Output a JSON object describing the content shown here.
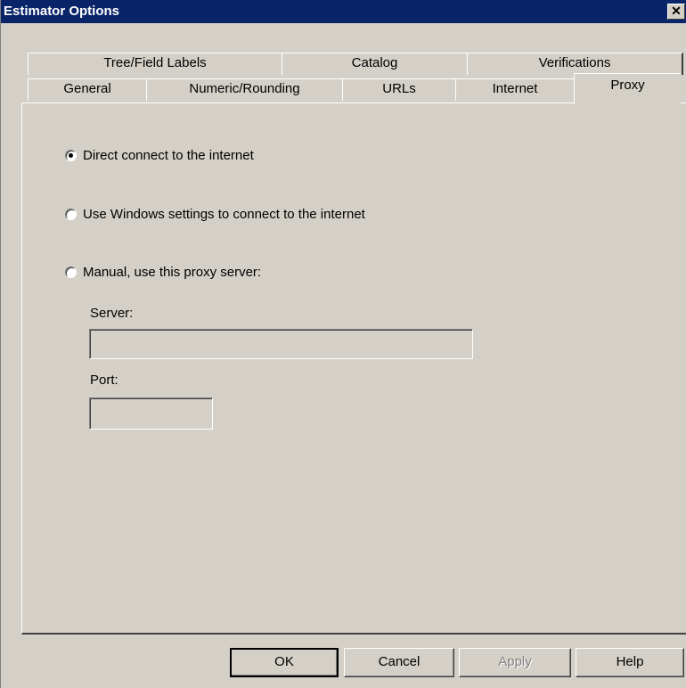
{
  "window": {
    "title": "Estimator Options",
    "close_glyph": "✕"
  },
  "tabs_back": [
    {
      "label": "Tree/Field Labels"
    },
    {
      "label": "Catalog"
    },
    {
      "label": "Verifications"
    }
  ],
  "tabs_front": [
    {
      "label": "General"
    },
    {
      "label": "Numeric/Rounding"
    },
    {
      "label": "URLs"
    },
    {
      "label": "Internet"
    },
    {
      "label": "Proxy",
      "active": true
    }
  ],
  "proxy": {
    "options": [
      {
        "label": "Direct connect to the internet",
        "checked": true
      },
      {
        "label": "Use Windows settings to connect to the internet",
        "checked": false
      },
      {
        "label": "Manual, use this proxy server:",
        "checked": false
      }
    ],
    "server_label": "Server:",
    "server_value": "",
    "port_label": "Port:",
    "port_value": ""
  },
  "buttons": {
    "ok": "OK",
    "cancel": "Cancel",
    "apply": "Apply",
    "help": "Help"
  },
  "icons": {
    "close": "close-icon",
    "radio": "radio-button-icon"
  },
  "colors": {
    "title_bar": "#0a246a",
    "dialog_face": "#d4d0c8"
  }
}
